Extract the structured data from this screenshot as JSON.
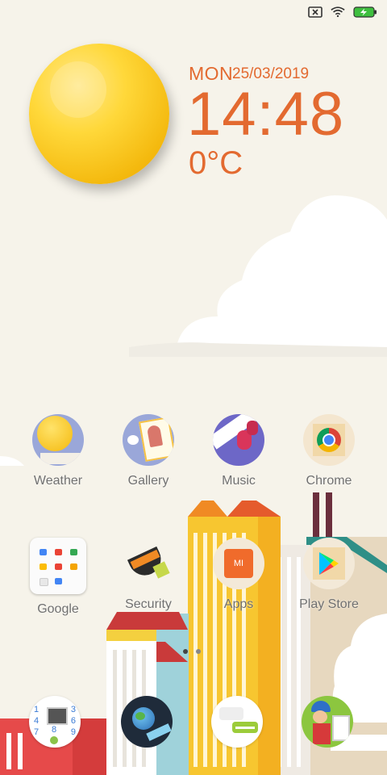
{
  "clock": {
    "day": "MON",
    "date": "25/03/2019",
    "time": "14:48",
    "temperature": "0°C"
  },
  "status_bar": {
    "icons": [
      "sim-blocked-icon",
      "wifi-icon",
      "battery-charging-icon"
    ]
  },
  "apps": [
    {
      "label": "Weather",
      "icon": "weather-icon"
    },
    {
      "label": "Gallery",
      "icon": "gallery-icon"
    },
    {
      "label": "Music",
      "icon": "music-icon"
    },
    {
      "label": "Chrome",
      "icon": "chrome-icon"
    },
    {
      "label": "Google",
      "icon": "google-folder-icon"
    },
    {
      "label": "Security",
      "icon": "security-icon"
    },
    {
      "label": "Apps",
      "icon": "mi-apps-icon"
    },
    {
      "label": "Play Store",
      "icon": "play-store-icon"
    }
  ],
  "dock": [
    {
      "icon": "phone-icon"
    },
    {
      "icon": "browser-icon"
    },
    {
      "icon": "messages-icon"
    },
    {
      "icon": "themes-icon"
    }
  ],
  "pager": {
    "pages": 2,
    "current": 1
  },
  "colors": {
    "accent": "#e36a30",
    "background": "#f6f3ea",
    "sun": "#ffd83a"
  }
}
